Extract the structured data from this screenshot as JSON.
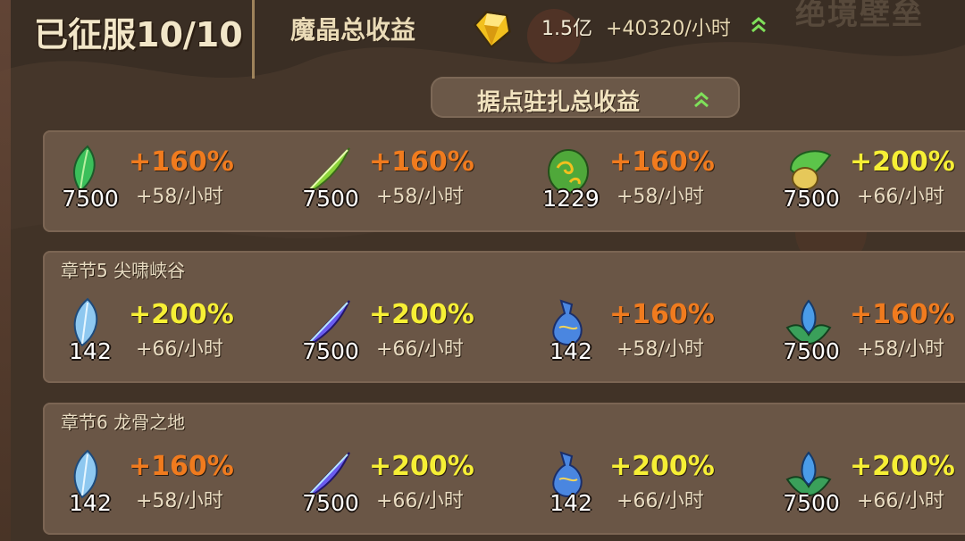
{
  "header": {
    "conquered_label": "已征服10/10",
    "income_label": "魔晶总收益",
    "income_total": "1.5亿",
    "income_rate": "+40320/小时",
    "corner_text": "绝境壁垒"
  },
  "summary_button": {
    "label": "据点驻扎总收益"
  },
  "sections": [
    {
      "chapter": "",
      "items": [
        {
          "icon": "green-leaf-icon",
          "count": "7500",
          "pct": "+160%",
          "rate": "+58/小时",
          "pct_color": "#f07b1e"
        },
        {
          "icon": "green-feather-icon",
          "count": "7500",
          "pct": "+160%",
          "rate": "+58/小时",
          "pct_color": "#f07b1e"
        },
        {
          "icon": "green-egg-icon",
          "count": "1229",
          "pct": "+160%",
          "rate": "+58/小时",
          "pct_color": "#f07b1e"
        },
        {
          "icon": "green-pod-icon",
          "count": "7500",
          "pct": "+200%",
          "rate": "+66/小时",
          "pct_color": "#f6ef35"
        }
      ]
    },
    {
      "chapter": "章节5 尖啸峡谷",
      "items": [
        {
          "icon": "ice-leaf-icon",
          "count": "142",
          "pct": "+200%",
          "rate": "+66/小时",
          "pct_color": "#f6ef35"
        },
        {
          "icon": "purple-feather-icon",
          "count": "7500",
          "pct": "+200%",
          "rate": "+66/小时",
          "pct_color": "#f6ef35"
        },
        {
          "icon": "blue-gourd-icon",
          "count": "142",
          "pct": "+160%",
          "rate": "+58/小时",
          "pct_color": "#f07b1e"
        },
        {
          "icon": "blue-flower-icon",
          "count": "7500",
          "pct": "+160%",
          "rate": "+58/小时",
          "pct_color": "#f07b1e"
        }
      ]
    },
    {
      "chapter": "章节6 龙骨之地",
      "items": [
        {
          "icon": "ice-leaf-icon",
          "count": "142",
          "pct": "+160%",
          "rate": "+58/小时",
          "pct_color": "#f07b1e"
        },
        {
          "icon": "purple-feather-icon",
          "count": "7500",
          "pct": "+200%",
          "rate": "+66/小时",
          "pct_color": "#f6ef35"
        },
        {
          "icon": "blue-gourd-icon",
          "count": "142",
          "pct": "+200%",
          "rate": "+66/小时",
          "pct_color": "#f6ef35"
        },
        {
          "icon": "blue-flower-icon",
          "count": "7500",
          "pct": "+200%",
          "rate": "+66/小时",
          "pct_color": "#f6ef35"
        }
      ]
    }
  ]
}
